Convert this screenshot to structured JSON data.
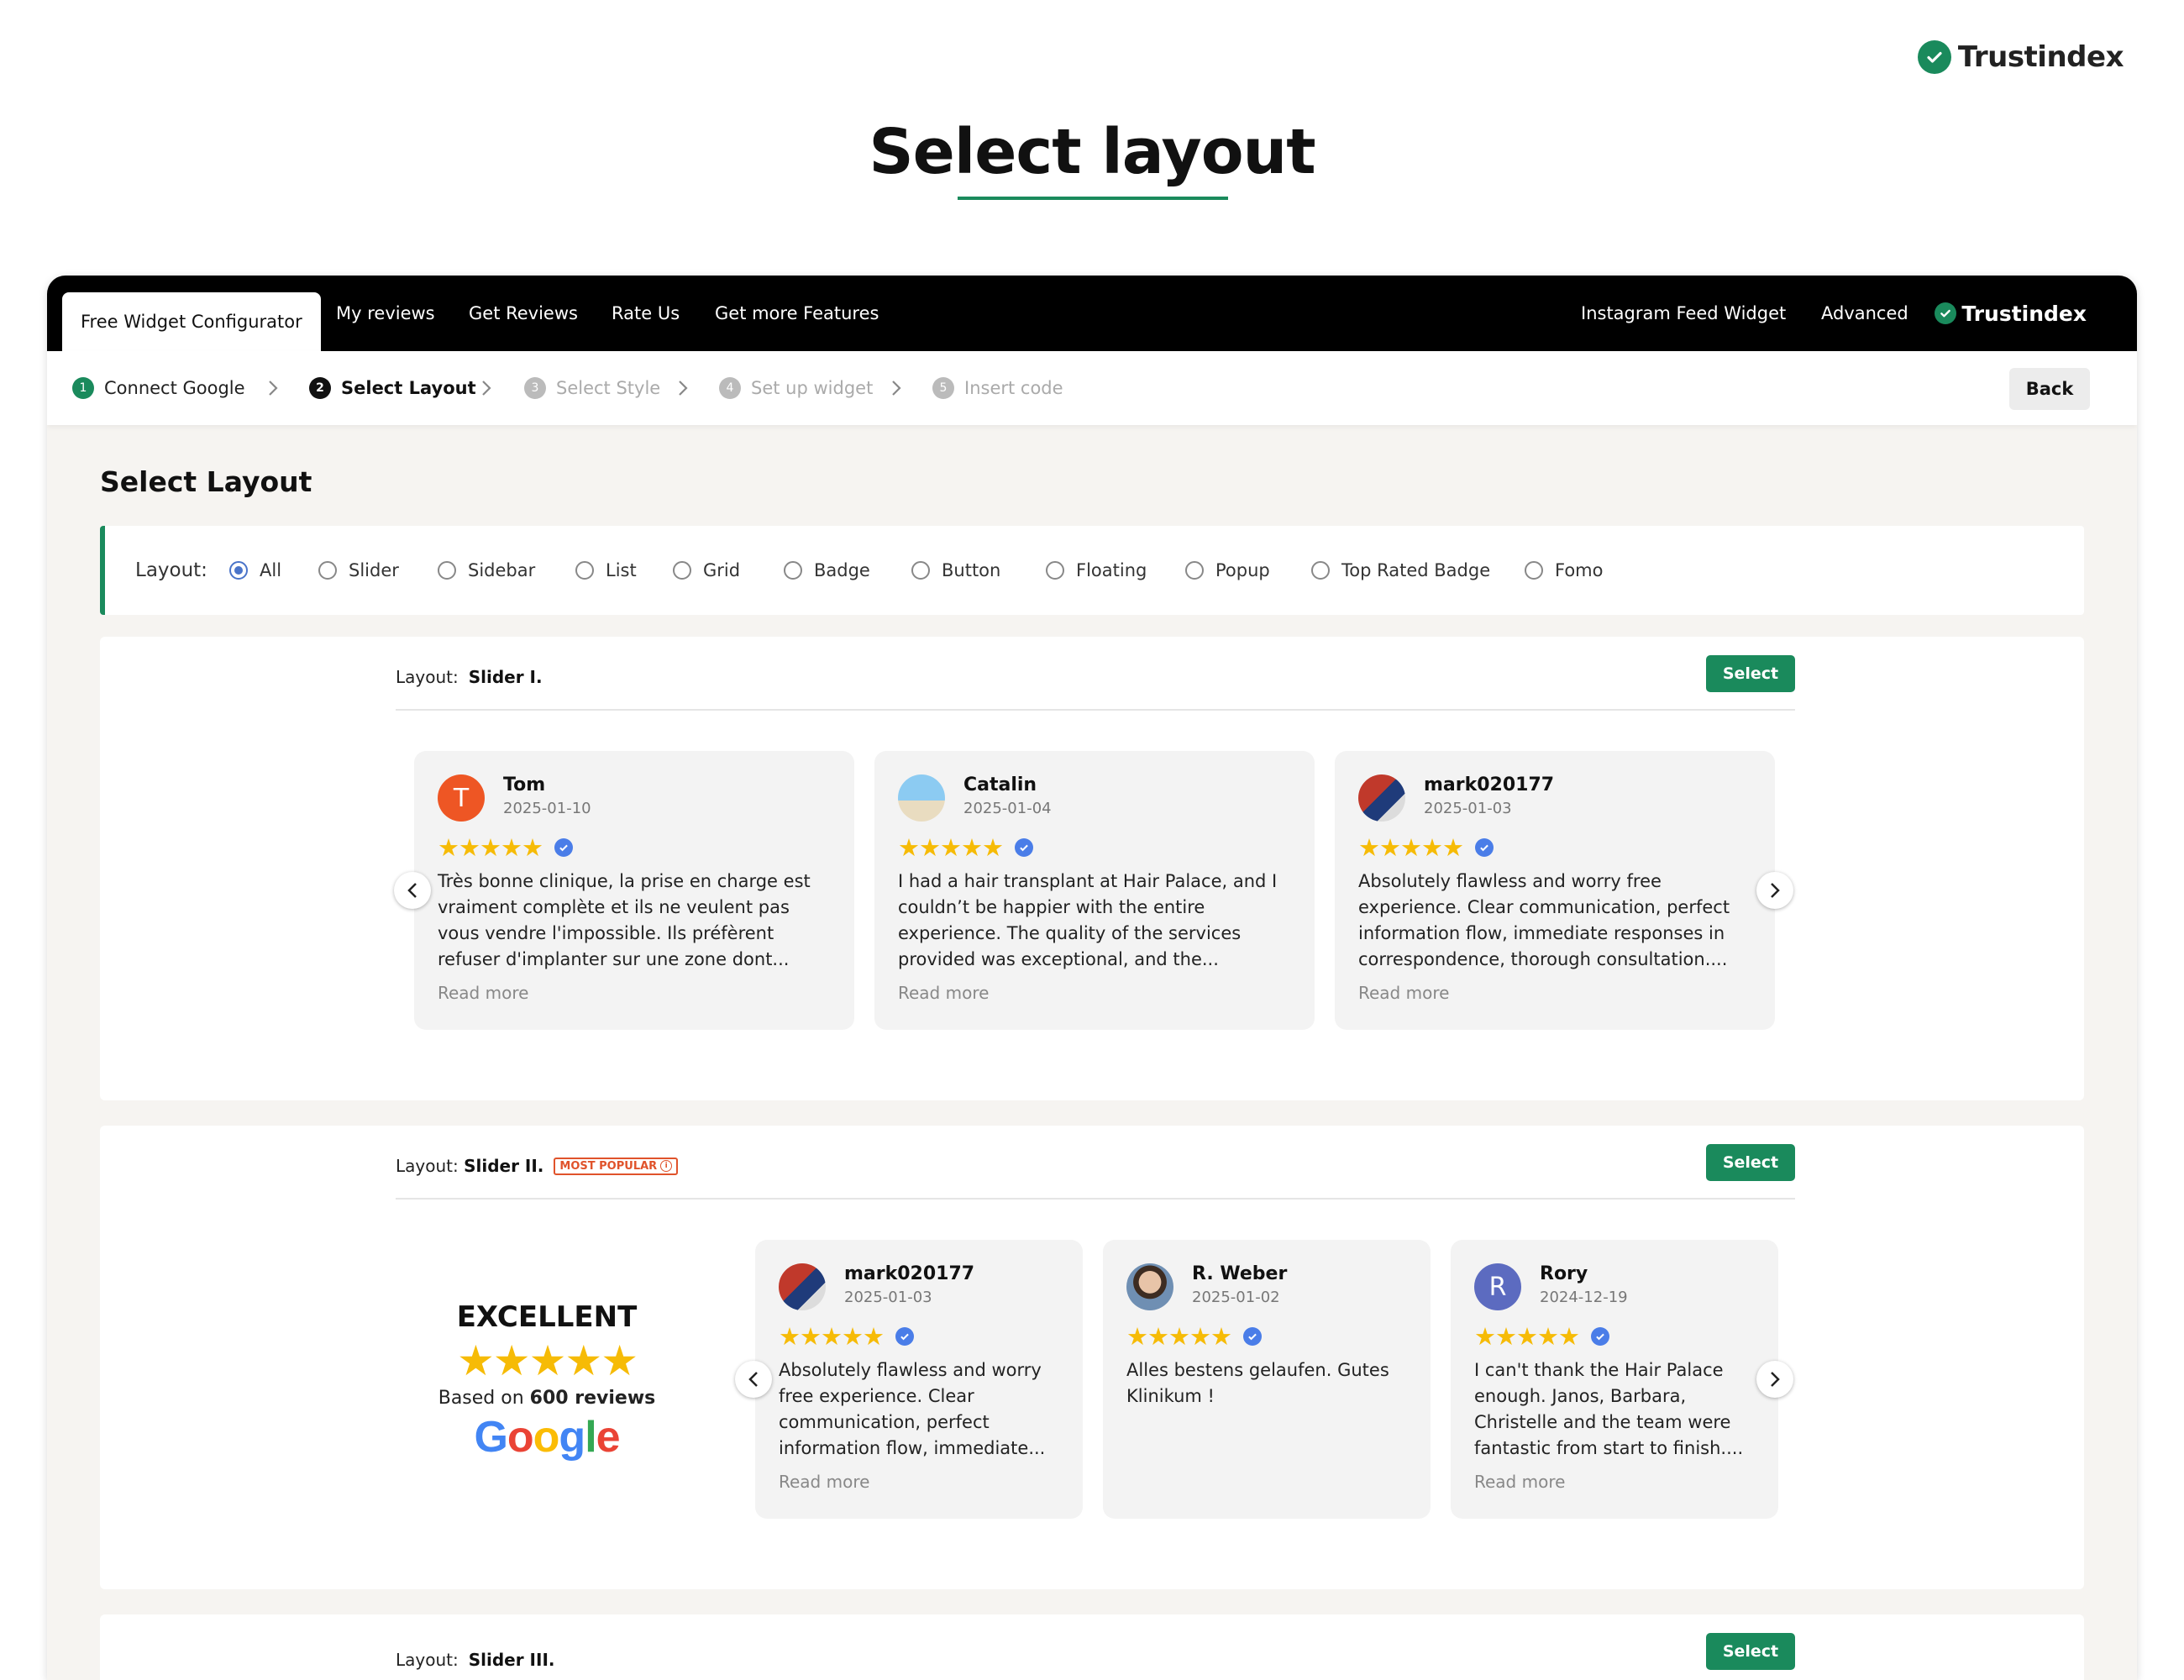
{
  "brand": {
    "name": "Trustindex"
  },
  "hero": {
    "title": "Select layout"
  },
  "nav": {
    "tabs": [
      "Free Widget Configurator",
      "My reviews",
      "Get Reviews",
      "Rate Us",
      "Get more Features"
    ],
    "right_links": [
      "Instagram Feed Widget",
      "Advanced"
    ],
    "brand": "Trustindex"
  },
  "steps": [
    {
      "num": "1",
      "label": "Connect Google"
    },
    {
      "num": "2",
      "label": "Select Layout"
    },
    {
      "num": "3",
      "label": "Select Style"
    },
    {
      "num": "4",
      "label": "Set up widget"
    },
    {
      "num": "5",
      "label": "Insert code"
    }
  ],
  "back_label": "Back",
  "section_title": "Select Layout",
  "filter": {
    "label": "Layout:",
    "selected": "All",
    "options": [
      "All",
      "Slider",
      "Sidebar",
      "List",
      "Grid",
      "Badge",
      "Button",
      "Floating",
      "Popup",
      "Top Rated Badge",
      "Fomo"
    ]
  },
  "layouts": [
    {
      "prefix": "Layout:",
      "name": "Slider I.",
      "badge": "",
      "select_label": "Select"
    },
    {
      "prefix": "Layout:",
      "name": "Slider II.",
      "badge": "MOST POPULAR",
      "select_label": "Select"
    },
    {
      "prefix": "Layout:",
      "name": "Slider III.",
      "badge": "",
      "select_label": "Select"
    }
  ],
  "slider1_reviews": [
    {
      "initial": "T",
      "name": "Tom",
      "date": "2025-01-10",
      "text": "Très bonne clinique, la prise en charge est vraiment complète et ils ne veulent pas vous vendre l'impossible. Ils préfèrent refuser d'implanter sur une zone dont...",
      "more": "Read more",
      "color": "#ee5624"
    },
    {
      "initial": "",
      "name": "Catalin",
      "date": "2025-01-04",
      "text": "I had a hair transplant at Hair Palace, and I couldn’t be happier with the entire experience. The quality of the services provided was exceptional, and the...",
      "more": "Read more",
      "color": "#7bb6e3"
    },
    {
      "initial": "",
      "name": "mark020177",
      "date": "2025-01-03",
      "text": "Absolutely flawless and worry free experience. Clear communication, perfect information flow, immediate responses in correspondence, thorough consultation....",
      "more": "Read more",
      "color": "#c0392b"
    }
  ],
  "slider2_summary": {
    "title": "EXCELLENT",
    "stars": "★★★★★",
    "based_prefix": "Based on",
    "based_count": "600 reviews",
    "google": [
      "G",
      "o",
      "o",
      "g",
      "l",
      "e"
    ]
  },
  "slider2_reviews": [
    {
      "initial": "",
      "name": "mark020177",
      "date": "2025-01-03",
      "text": "Absolutely flawless and worry free experience. Clear communication, perfect information flow, immediate...",
      "more": "Read more",
      "color": "#c0392b"
    },
    {
      "initial": "",
      "name": "R. Weber",
      "date": "2025-01-02",
      "text": "Alles bestens gelaufen. Gutes Klinikum !",
      "more": "",
      "color": "#8a6d55"
    },
    {
      "initial": "R",
      "name": "Rory",
      "date": "2024-12-19",
      "text": "I can't thank the Hair Palace enough. Janos, Barbara, Christelle and the team were fantastic from start to finish....",
      "more": "Read more",
      "color": "#5c6bc0"
    }
  ],
  "stars": "★★★★★",
  "colors": {
    "accent": "#1a8a5c",
    "star": "#f6bb06",
    "verified": "#4a7de8",
    "badge": "#e0532b"
  }
}
